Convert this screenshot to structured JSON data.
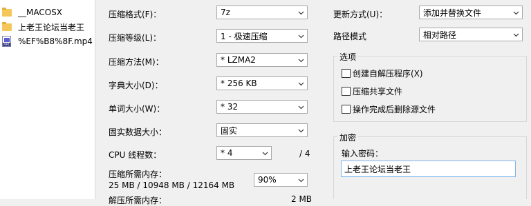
{
  "file_list": [
    {
      "name": "__MACOSX",
      "type": "folder"
    },
    {
      "name": "上老王论坛当老王",
      "type": "folder"
    },
    {
      "name": "%EF%B8%8F.mp4",
      "type": "video"
    }
  ],
  "mp4_badge": "MP4",
  "form": {
    "archive_format": {
      "label": "压缩格式(F)：",
      "value": "7z"
    },
    "compression_level": {
      "label": "压缩等级(L)：",
      "value": "1 - 极速压缩"
    },
    "compression_method": {
      "label": "压缩方法(M)：",
      "value": "* LZMA2"
    },
    "dictionary_size": {
      "label": "字典大小(D)：",
      "value": "* 256 KB"
    },
    "word_size": {
      "label": "单词大小(W)：",
      "value": "* 32"
    },
    "solid_block_size": {
      "label": "固实数据大小：",
      "value": "固实"
    },
    "cpu_threads": {
      "label": "CPU 线程数：",
      "value": "* 4",
      "total": "/ 4"
    },
    "memory_compress": {
      "label": "压缩所需内存：",
      "detail": "25 MB / 10948 MB / 12164 MB",
      "percent": "90%"
    },
    "memory_decompress": {
      "label": "解压所需内存：",
      "value": "2 MB"
    }
  },
  "right": {
    "update_mode": {
      "label": "更新方式(U)：",
      "value": "添加并替换文件"
    },
    "path_mode": {
      "label": "路径模式",
      "value": "相对路径"
    },
    "options": {
      "title": "选项",
      "items": [
        {
          "label": "创建自解压程序(X)",
          "checked": false
        },
        {
          "label": "压缩共享文件",
          "checked": false
        },
        {
          "label": "操作完成后删除源文件",
          "checked": false
        }
      ]
    },
    "encryption": {
      "title": "加密",
      "password_label": "输入密码：",
      "password_value": "上老王论坛当老王"
    }
  }
}
